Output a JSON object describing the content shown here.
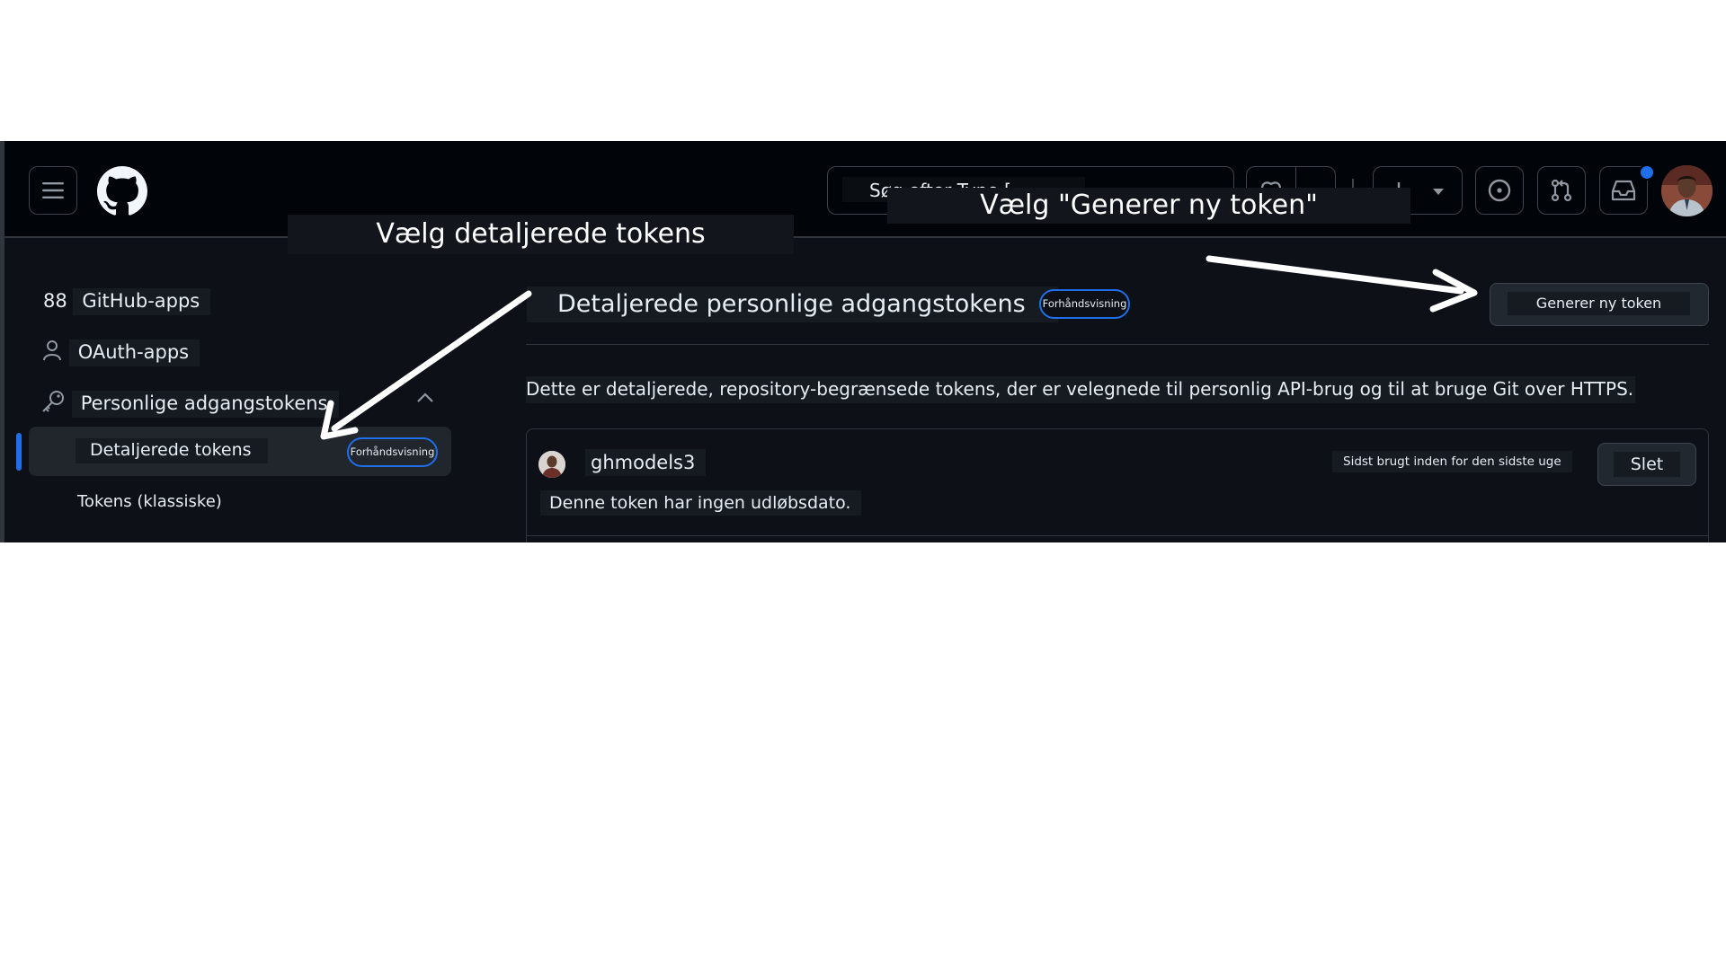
{
  "header": {
    "search_text": "Søg efter Type [",
    "icons": [
      "menu-icon",
      "github-logo-icon",
      "copilot-icon",
      "plus-icon",
      "issues-icon",
      "pull-requests-icon",
      "inbox-icon"
    ]
  },
  "annotations": {
    "left": "Vælg detaljerede tokens",
    "right": "Vælg \"Generer ny token\""
  },
  "sidebar": {
    "items": [
      {
        "label": "GitHub-apps",
        "icon_text": "88"
      },
      {
        "label": "OAuth-apps"
      },
      {
        "label": "Personlige adgangstokens"
      },
      {
        "label": "Detaljerede tokens",
        "badge": "Forhåndsvisning",
        "active": true
      },
      {
        "label": "Tokens (klassiske)"
      }
    ]
  },
  "main": {
    "title": "Detaljerede personlige adgangstokens",
    "badge": "Forhåndsvisning",
    "generate_button": "Generer ny token",
    "description": "Dette er detaljerede, repository-begrænsede tokens, der er velegnede til personlig API-brug og til at bruge Git over HTTPS.",
    "token": {
      "name": "ghmodels3",
      "last_used": "Sidst brugt inden for den sidste uge",
      "delete_button": "Slet",
      "expiration": "Denne token har ingen udløbsdato."
    }
  },
  "colors": {
    "background": "#0d1117",
    "header": "#010409",
    "accent": "#1f6feb",
    "border": "#30363d",
    "text": "#e6edf3"
  }
}
